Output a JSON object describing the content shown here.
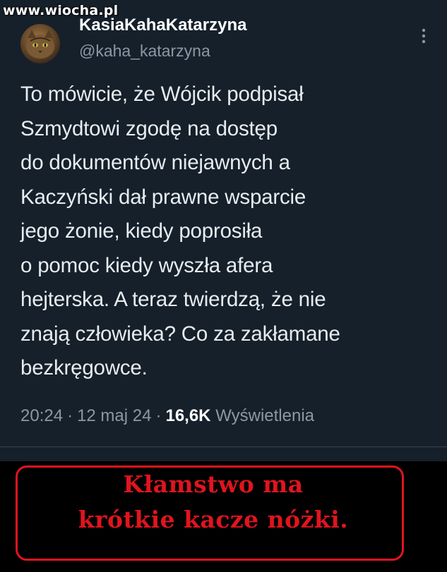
{
  "watermark": "www.wiocha.pl",
  "tweet": {
    "display_name": "KasiaKahaKatarzyna",
    "handle": "@kaha_katarzyna",
    "text": "To mówicie, że Wójcik podpisał\nSzmydtowi zgodę na dostęp\ndo dokumentów niejawnych a\nKaczyński dał prawne wsparcie\njego żonie, kiedy poprosiła\no pomoc kiedy wyszła afera\nhejterska. A teraz twierdzą, że nie\nznają człowieka? Co za zakłamane\nbezkręgowce.",
    "time": "20:24",
    "date": "12 maj 24",
    "views_count": "16,6K",
    "views_label": "Wyświetlenia",
    "more_icon": "vertical-ellipsis-icon"
  },
  "caption": {
    "line1": "Kłamstwo ma",
    "line2": "krótkie kacze nóżki."
  },
  "colors": {
    "background": "#15202b",
    "text": "#e8ecef",
    "muted": "#8b98a5",
    "caption_red": "#e0141e"
  }
}
